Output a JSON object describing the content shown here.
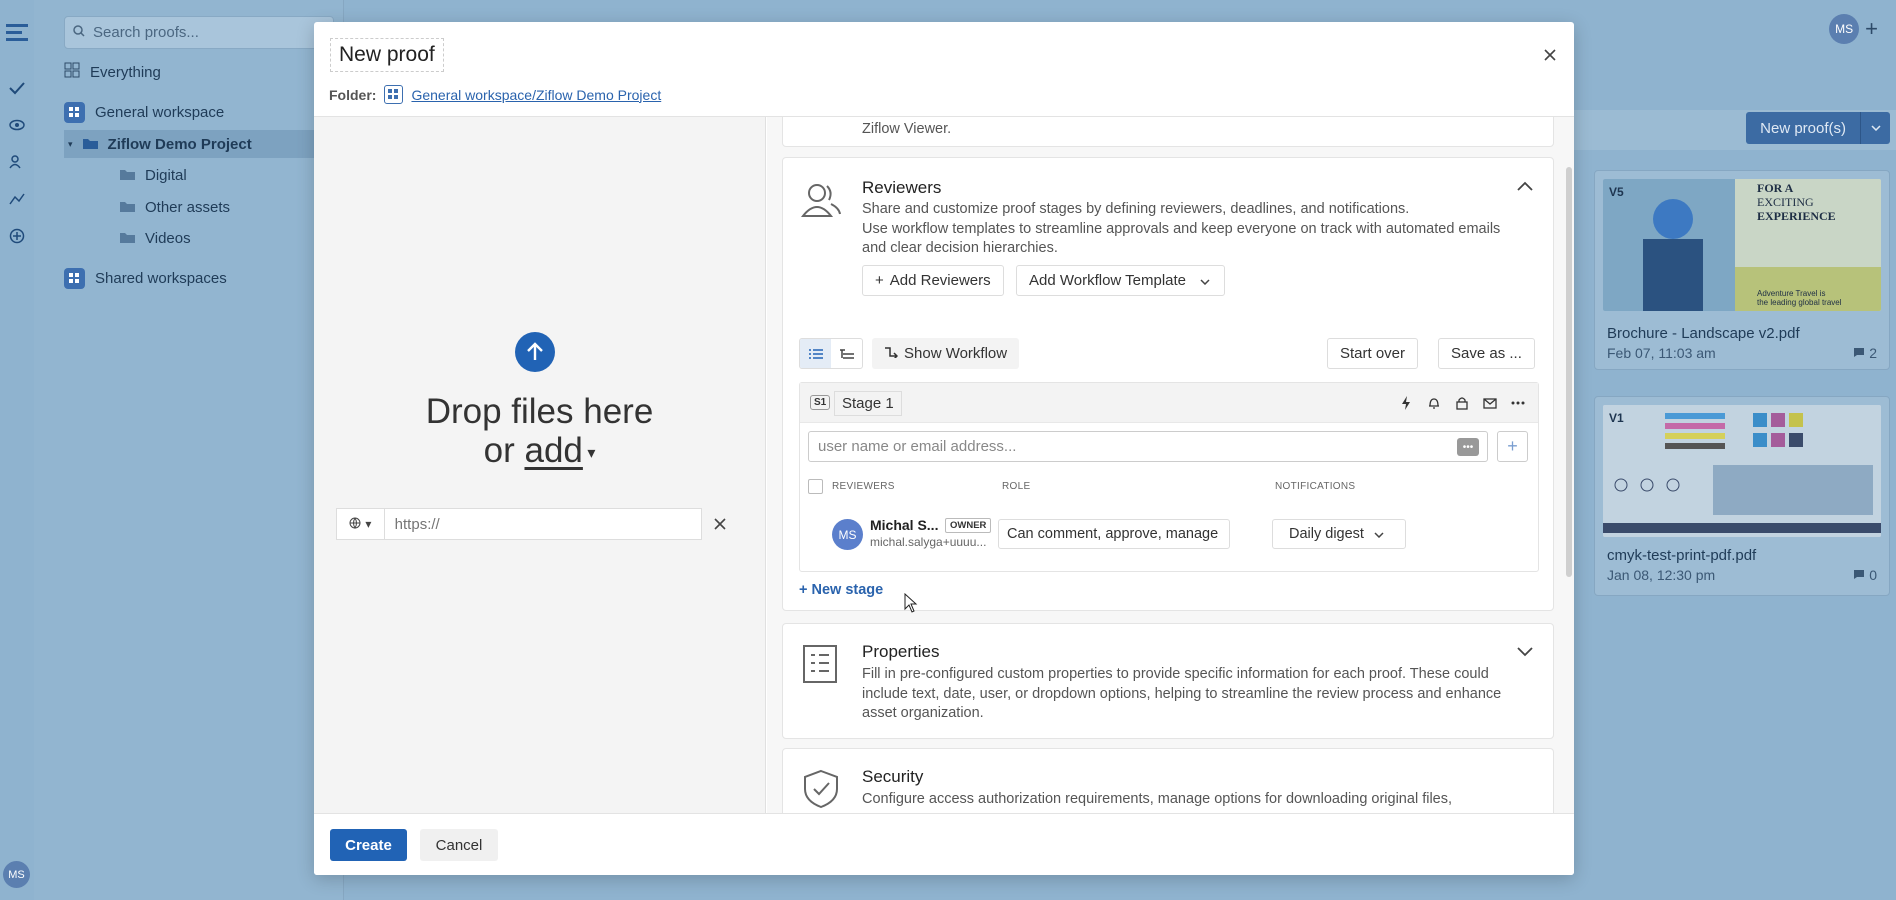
{
  "app": {
    "search_placeholder": "Search proofs...",
    "nav": {
      "everything": "Everything",
      "general_workspace": "General workspace",
      "project": "Ziflow Demo Project",
      "folders": [
        "Digital",
        "Other assets",
        "Videos"
      ],
      "shared": "Shared workspaces"
    },
    "user_initials": "MS",
    "new_proofs_label": "New proof(s)",
    "cards": [
      {
        "version": "V5",
        "title": "Brochure - Landscape v2.pdf",
        "date": "Feb 07, 11:03 am",
        "comments": "2"
      },
      {
        "version": "V1",
        "title": "cmyk-test-print-pdf.pdf",
        "date": "Jan 08, 12:30 pm",
        "comments": "0"
      }
    ],
    "brochure_text": {
      "line1": "FOR A",
      "line2": "EXCITING",
      "line3": "EXPERIENCE",
      "line4": "Adventure Travel is",
      "line5": "the leading global travel"
    }
  },
  "modal": {
    "title": "New proof",
    "folder_label": "Folder:",
    "folder_path": "General workspace/Ziflow Demo Project",
    "drop_line1": "Drop files here",
    "drop_or": "or ",
    "drop_add": "add",
    "url_placeholder": "https://",
    "viewer_fragment": "Ziflow Viewer.",
    "reviewers": {
      "title": "Reviewers",
      "desc1": "Share and customize proof stages by defining reviewers, deadlines, and notifications.",
      "desc2": "Use workflow templates to streamline approvals and keep everyone on track with automated emails and clear decision hierarchies.",
      "add_reviewers": "Add Reviewers",
      "add_template": "Add Workflow Template",
      "show_workflow": "Show Workflow",
      "start_over": "Start over",
      "save_as": "Save as ...",
      "stage_badge": "S1",
      "stage_name": "Stage 1",
      "user_placeholder": "user name or email address...",
      "col_reviewers": "REVIEWERS",
      "col_role": "ROLE",
      "col_notifications": "NOTIFICATIONS",
      "reviewer_name": "Michal S...",
      "reviewer_badge": "OWNER",
      "reviewer_email": "michal.salyga+uuuu...",
      "reviewer_role": "Can comment, approve, manage",
      "reviewer_notif": "Daily digest",
      "new_stage": "+ New stage"
    },
    "properties": {
      "title": "Properties",
      "desc": "Fill in pre-configured custom properties to provide specific information for each proof. These could include text, date, user, or dropdown options, helping to streamline the review process and enhance asset organization."
    },
    "security": {
      "title": "Security",
      "desc": "Configure access authorization requirements, manage options for downloading original files,"
    },
    "create": "Create",
    "cancel": "Cancel"
  }
}
